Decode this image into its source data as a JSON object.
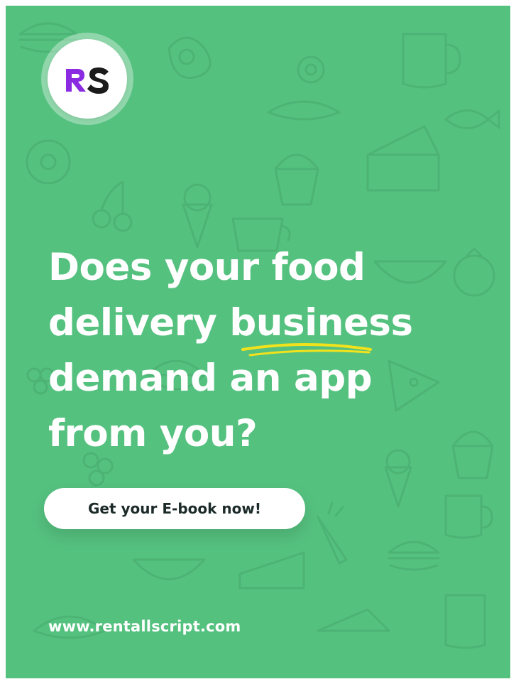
{
  "brand": {
    "logo_text": "RS",
    "logo_colors": {
      "r": "#8a2be2",
      "s": "#1b1b1b"
    }
  },
  "headline": {
    "line1": "Does your food",
    "line2_pre": "delivery ",
    "line2_highlight": "business",
    "line3": "demand an app",
    "line4": "from you?"
  },
  "cta": {
    "label": "Get your E-book now!"
  },
  "footer": {
    "url": "www.rentallscript.com"
  },
  "colors": {
    "background": "#55c17f",
    "text": "#ffffff",
    "highlight_scribble": "#f2e21b",
    "button_bg": "#ffffff",
    "button_text": "#1c2b2a"
  },
  "decorations": [
    "food-doodle-pattern-background"
  ]
}
